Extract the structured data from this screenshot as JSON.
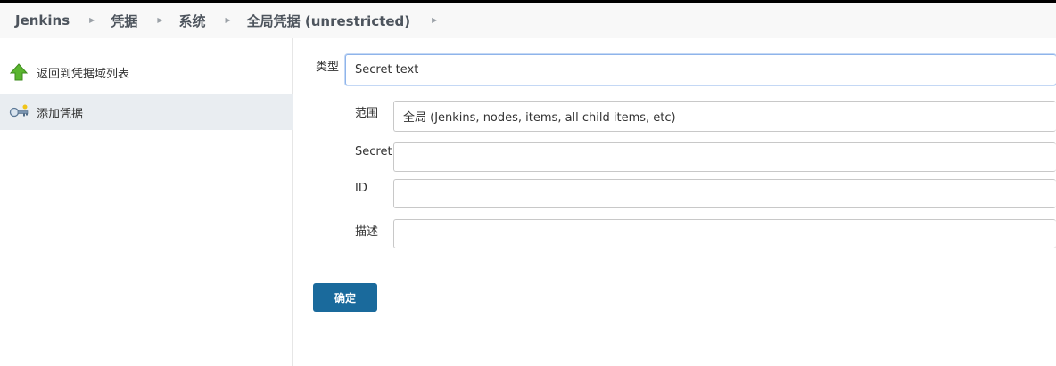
{
  "breadcrumbs": [
    {
      "label": "Jenkins"
    },
    {
      "label": "凭据"
    },
    {
      "label": "系统"
    },
    {
      "label": "全局凭据 (unrestricted)"
    }
  ],
  "sidepanel": {
    "tasks": [
      {
        "label": "返回到凭据域列表",
        "icon": "up-arrow-icon"
      },
      {
        "label": "添加凭据",
        "icon": "key-icon"
      }
    ]
  },
  "form": {
    "kind": {
      "label": "类型",
      "value": "Secret text"
    },
    "scope": {
      "label": "范围",
      "value": "全局 (Jenkins, nodes, items, all child items, etc)"
    },
    "secret": {
      "label": "Secret",
      "value": ""
    },
    "id": {
      "label": "ID",
      "value": ""
    },
    "description": {
      "label": "描述",
      "value": ""
    },
    "submit_label": "确定"
  },
  "colors": {
    "primary_button": "#1a6a9c",
    "selected_task_bg": "#e9edf1",
    "focus_border": "#8fb4ea"
  }
}
